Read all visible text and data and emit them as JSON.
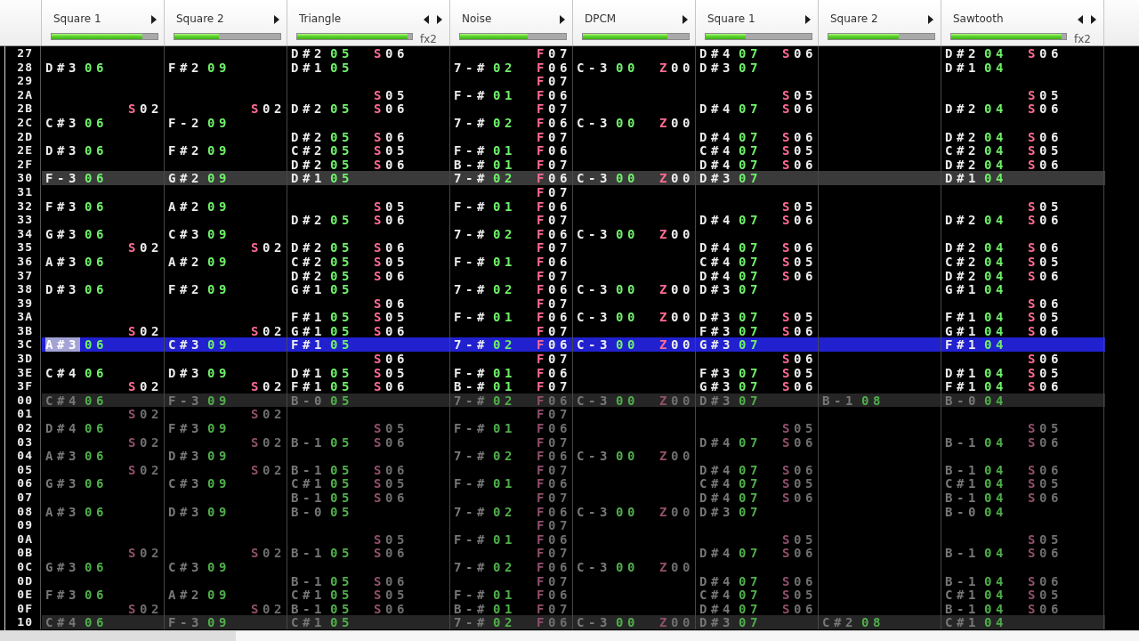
{
  "channels": [
    {
      "name": "Square 1",
      "contract_arrow": false,
      "expand_arrow": true,
      "level": 0.86
    },
    {
      "name": "Square 2",
      "contract_arrow": false,
      "expand_arrow": true,
      "level": 0.42
    },
    {
      "name": "Triangle",
      "contract_arrow": true,
      "expand_arrow": true,
      "level": 0.96,
      "fx_label": "fx2"
    },
    {
      "name": "Noise",
      "contract_arrow": false,
      "expand_arrow": true,
      "level": 0.64
    },
    {
      "name": "DPCM",
      "contract_arrow": false,
      "expand_arrow": true,
      "level": 0.8
    },
    {
      "name": "Square 1",
      "contract_arrow": false,
      "expand_arrow": true,
      "level": 0.38
    },
    {
      "name": "Square 2",
      "contract_arrow": false,
      "expand_arrow": true,
      "level": 0.66
    },
    {
      "name": "Sawtooth",
      "contract_arrow": true,
      "expand_arrow": true,
      "level": 0.96,
      "fx_label": "fx2"
    }
  ],
  "pattern": {
    "rows": [
      {
        "number": "27",
        "selected": false,
        "highlight": false,
        "cells": [
          null,
          null,
          {
            "note": "D#2",
            "instrument": "05",
            "effects": [
              "S06"
            ]
          },
          {
            "effects": [
              "F07"
            ]
          },
          null,
          {
            "note": "D#4",
            "instrument": "07",
            "effects": [
              "S06"
            ]
          },
          null,
          {
            "note": "D#2",
            "instrument": "04",
            "effects": [
              "S06"
            ]
          }
        ]
      },
      {
        "number": "28",
        "selected": false,
        "highlight": false,
        "cells": [
          {
            "note": "D#3",
            "instrument": "06"
          },
          {
            "note": "F#2",
            "instrument": "09"
          },
          {
            "note": "D#1",
            "instrument": "05"
          },
          {
            "note": "7-#",
            "instrument": "02",
            "effects": [
              "F06"
            ]
          },
          {
            "note": "C-3",
            "instrument": "00",
            "effects": [
              "Z00"
            ]
          },
          {
            "note": "D#3",
            "instrument": "07"
          },
          null,
          {
            "note": "D#1",
            "instrument": "04"
          }
        ]
      },
      {
        "number": "29",
        "selected": false,
        "highlight": false,
        "cells": [
          null,
          null,
          null,
          {
            "effects": [
              "F07"
            ]
          },
          null,
          null,
          null,
          null
        ]
      },
      {
        "number": "2A",
        "selected": false,
        "highlight": false,
        "cells": [
          null,
          null,
          {
            "effects": [
              "S05"
            ]
          },
          {
            "note": "F-#",
            "instrument": "01",
            "effects": [
              "F06"
            ]
          },
          null,
          {
            "effects": [
              "S05"
            ]
          },
          null,
          {
            "effects": [
              "S05"
            ]
          }
        ]
      },
      {
        "number": "2B",
        "selected": false,
        "highlight": false,
        "cells": [
          {
            "effects": [
              "S02"
            ]
          },
          {
            "effects": [
              "S02"
            ]
          },
          {
            "note": "D#2",
            "instrument": "05",
            "effects": [
              "S06"
            ]
          },
          {
            "effects": [
              "F07"
            ]
          },
          null,
          {
            "note": "D#4",
            "instrument": "07",
            "effects": [
              "S06"
            ]
          },
          null,
          {
            "note": "D#2",
            "instrument": "04",
            "effects": [
              "S06"
            ]
          }
        ]
      },
      {
        "number": "2C",
        "selected": false,
        "highlight": false,
        "cells": [
          {
            "note": "C#3",
            "instrument": "06"
          },
          {
            "note": "F-2",
            "instrument": "09"
          },
          null,
          {
            "note": "7-#",
            "instrument": "02",
            "effects": [
              "F06"
            ]
          },
          {
            "note": "C-3",
            "instrument": "00",
            "effects": [
              "Z00"
            ]
          },
          null,
          null,
          null
        ]
      },
      {
        "number": "2D",
        "selected": false,
        "highlight": false,
        "cells": [
          null,
          null,
          {
            "note": "D#2",
            "instrument": "05",
            "effects": [
              "S06"
            ]
          },
          {
            "effects": [
              "F07"
            ]
          },
          null,
          {
            "note": "D#4",
            "instrument": "07",
            "effects": [
              "S06"
            ]
          },
          null,
          {
            "note": "D#2",
            "instrument": "04",
            "effects": [
              "S06"
            ]
          }
        ]
      },
      {
        "number": "2E",
        "selected": false,
        "highlight": false,
        "cells": [
          {
            "note": "D#3",
            "instrument": "06"
          },
          {
            "note": "F#2",
            "instrument": "09"
          },
          {
            "note": "C#2",
            "instrument": "05",
            "effects": [
              "S05"
            ]
          },
          {
            "note": "F-#",
            "instrument": "01",
            "effects": [
              "F06"
            ]
          },
          null,
          {
            "note": "C#4",
            "instrument": "07",
            "effects": [
              "S05"
            ]
          },
          null,
          {
            "note": "C#2",
            "instrument": "04",
            "effects": [
              "S05"
            ]
          }
        ]
      },
      {
        "number": "2F",
        "selected": false,
        "highlight": false,
        "cells": [
          null,
          null,
          {
            "note": "D#2",
            "instrument": "05",
            "effects": [
              "S06"
            ]
          },
          {
            "note": "B-#",
            "instrument": "01",
            "effects": [
              "F07"
            ]
          },
          null,
          {
            "note": "D#4",
            "instrument": "07",
            "effects": [
              "S06"
            ]
          },
          null,
          {
            "note": "D#2",
            "instrument": "04",
            "effects": [
              "S06"
            ]
          }
        ]
      },
      {
        "number": "30",
        "selected": false,
        "highlight": true,
        "cells": [
          {
            "note": "F-3",
            "instrument": "06"
          },
          {
            "note": "G#2",
            "instrument": "09"
          },
          {
            "note": "D#1",
            "instrument": "05"
          },
          {
            "note": "7-#",
            "instrument": "02",
            "effects": [
              "F06"
            ]
          },
          {
            "note": "C-3",
            "instrument": "00",
            "effects": [
              "Z00"
            ]
          },
          {
            "note": "D#3",
            "instrument": "07"
          },
          null,
          {
            "note": "D#1",
            "instrument": "04"
          }
        ]
      },
      {
        "number": "31",
        "selected": false,
        "highlight": false,
        "cells": [
          null,
          null,
          null,
          {
            "effects": [
              "F07"
            ]
          },
          null,
          null,
          null,
          null
        ]
      },
      {
        "number": "32",
        "selected": false,
        "highlight": false,
        "cells": [
          {
            "note": "F#3",
            "instrument": "06"
          },
          {
            "note": "A#2",
            "instrument": "09"
          },
          {
            "effects": [
              "S05"
            ]
          },
          {
            "note": "F-#",
            "instrument": "01",
            "effects": [
              "F06"
            ]
          },
          null,
          {
            "effects": [
              "S05"
            ]
          },
          null,
          {
            "effects": [
              "S05"
            ]
          }
        ]
      },
      {
        "number": "33",
        "selected": false,
        "highlight": false,
        "cells": [
          null,
          null,
          {
            "note": "D#2",
            "instrument": "05",
            "effects": [
              "S06"
            ]
          },
          {
            "effects": [
              "F07"
            ]
          },
          null,
          {
            "note": "D#4",
            "instrument": "07",
            "effects": [
              "S06"
            ]
          },
          null,
          {
            "note": "D#2",
            "instrument": "04",
            "effects": [
              "S06"
            ]
          }
        ]
      },
      {
        "number": "34",
        "selected": false,
        "highlight": false,
        "cells": [
          {
            "note": "G#3",
            "instrument": "06"
          },
          {
            "note": "C#3",
            "instrument": "09"
          },
          null,
          {
            "note": "7-#",
            "instrument": "02",
            "effects": [
              "F06"
            ]
          },
          {
            "note": "C-3",
            "instrument": "00",
            "effects": [
              "Z00"
            ]
          },
          null,
          null,
          null
        ]
      },
      {
        "number": "35",
        "selected": false,
        "highlight": false,
        "cells": [
          {
            "effects": [
              "S02"
            ]
          },
          {
            "effects": [
              "S02"
            ]
          },
          {
            "note": "D#2",
            "instrument": "05",
            "effects": [
              "S06"
            ]
          },
          {
            "effects": [
              "F07"
            ]
          },
          null,
          {
            "note": "D#4",
            "instrument": "07",
            "effects": [
              "S06"
            ]
          },
          null,
          {
            "note": "D#2",
            "instrument": "04",
            "effects": [
              "S06"
            ]
          }
        ]
      },
      {
        "number": "36",
        "selected": false,
        "highlight": false,
        "cells": [
          {
            "note": "A#3",
            "instrument": "06"
          },
          {
            "note": "A#2",
            "instrument": "09"
          },
          {
            "note": "C#2",
            "instrument": "05",
            "effects": [
              "S05"
            ]
          },
          {
            "note": "F-#",
            "instrument": "01",
            "effects": [
              "F06"
            ]
          },
          null,
          {
            "note": "C#4",
            "instrument": "07",
            "effects": [
              "S05"
            ]
          },
          null,
          {
            "note": "C#2",
            "instrument": "04",
            "effects": [
              "S05"
            ]
          }
        ]
      },
      {
        "number": "37",
        "selected": false,
        "highlight": false,
        "cells": [
          null,
          null,
          {
            "note": "D#2",
            "instrument": "05",
            "effects": [
              "S06"
            ]
          },
          {
            "effects": [
              "F07"
            ]
          },
          null,
          {
            "note": "D#4",
            "instrument": "07",
            "effects": [
              "S06"
            ]
          },
          null,
          {
            "note": "D#2",
            "instrument": "04",
            "effects": [
              "S06"
            ]
          }
        ]
      },
      {
        "number": "38",
        "selected": false,
        "highlight": false,
        "cells": [
          {
            "note": "D#3",
            "instrument": "06"
          },
          {
            "note": "F#2",
            "instrument": "09"
          },
          {
            "note": "G#1",
            "instrument": "05"
          },
          {
            "note": "7-#",
            "instrument": "02",
            "effects": [
              "F06"
            ]
          },
          {
            "note": "C-3",
            "instrument": "00",
            "effects": [
              "Z00"
            ]
          },
          {
            "note": "D#3",
            "instrument": "07"
          },
          null,
          {
            "note": "G#1",
            "instrument": "04"
          }
        ]
      },
      {
        "number": "39",
        "selected": false,
        "highlight": false,
        "cells": [
          null,
          null,
          {
            "effects": [
              "S06"
            ]
          },
          {
            "effects": [
              "F07"
            ]
          },
          null,
          null,
          null,
          {
            "effects": [
              "S06"
            ]
          }
        ]
      },
      {
        "number": "3A",
        "selected": false,
        "highlight": false,
        "cells": [
          null,
          null,
          {
            "note": "F#1",
            "instrument": "05",
            "effects": [
              "S05"
            ]
          },
          {
            "note": "F-#",
            "instrument": "01",
            "effects": [
              "F06"
            ]
          },
          {
            "note": "C-3",
            "instrument": "00",
            "effects": [
              "Z00"
            ]
          },
          {
            "note": "D#3",
            "instrument": "07",
            "effects": [
              "S05"
            ]
          },
          null,
          {
            "note": "F#1",
            "instrument": "04",
            "effects": [
              "S05"
            ]
          }
        ]
      },
      {
        "number": "3B",
        "selected": false,
        "highlight": false,
        "cells": [
          {
            "effects": [
              "S02"
            ]
          },
          {
            "effects": [
              "S02"
            ]
          },
          {
            "note": "G#1",
            "instrument": "05",
            "effects": [
              "S06"
            ]
          },
          {
            "effects": [
              "F07"
            ]
          },
          null,
          {
            "note": "F#3",
            "instrument": "07",
            "effects": [
              "S06"
            ]
          },
          null,
          {
            "note": "G#1",
            "instrument": "04",
            "effects": [
              "S06"
            ]
          }
        ]
      },
      {
        "number": "3C",
        "selected": true,
        "highlight": false,
        "cells": [
          {
            "note": "A#3",
            "instrument": "06",
            "cursor": true
          },
          {
            "note": "C#3",
            "instrument": "09"
          },
          {
            "note": "F#1",
            "instrument": "05"
          },
          {
            "note": "7-#",
            "instrument": "02",
            "effects": [
              "F06"
            ]
          },
          {
            "note": "C-3",
            "instrument": "00",
            "effects": [
              "Z00"
            ]
          },
          {
            "note": "G#3",
            "instrument": "07"
          },
          null,
          {
            "note": "F#1",
            "instrument": "04"
          }
        ]
      },
      {
        "number": "3D",
        "selected": false,
        "highlight": false,
        "cells": [
          null,
          null,
          {
            "effects": [
              "S06"
            ]
          },
          {
            "effects": [
              "F07"
            ]
          },
          null,
          {
            "effects": [
              "S06"
            ]
          },
          null,
          {
            "effects": [
              "S06"
            ]
          }
        ]
      },
      {
        "number": "3E",
        "selected": false,
        "highlight": false,
        "cells": [
          {
            "note": "C#4",
            "instrument": "06"
          },
          {
            "note": "D#3",
            "instrument": "09"
          },
          {
            "note": "D#1",
            "instrument": "05",
            "effects": [
              "S05"
            ]
          },
          {
            "note": "F-#",
            "instrument": "01",
            "effects": [
              "F06"
            ]
          },
          null,
          {
            "note": "F#3",
            "instrument": "07",
            "effects": [
              "S05"
            ]
          },
          null,
          {
            "note": "D#1",
            "instrument": "04",
            "effects": [
              "S05"
            ]
          }
        ]
      },
      {
        "number": "3F",
        "selected": false,
        "highlight": false,
        "cells": [
          {
            "effects": [
              "S02"
            ]
          },
          {
            "effects": [
              "S02"
            ]
          },
          {
            "note": "F#1",
            "instrument": "05",
            "effects": [
              "S06"
            ]
          },
          {
            "note": "B-#",
            "instrument": "01",
            "effects": [
              "F07"
            ]
          },
          null,
          {
            "note": "G#3",
            "instrument": "07",
            "effects": [
              "S06"
            ]
          },
          null,
          {
            "note": "F#1",
            "instrument": "04",
            "effects": [
              "S06"
            ]
          }
        ]
      }
    ]
  },
  "next_pattern_preview": {
    "rows": [
      {
        "number": "00",
        "selected": false,
        "highlight": true,
        "cells": [
          {
            "note": "C#4",
            "instrument": "06"
          },
          {
            "note": "F-3",
            "instrument": "09"
          },
          {
            "note": "B-0",
            "instrument": "05"
          },
          {
            "note": "7-#",
            "instrument": "02",
            "effects": [
              "F06"
            ]
          },
          {
            "note": "C-3",
            "instrument": "00",
            "effects": [
              "Z00"
            ]
          },
          {
            "note": "D#3",
            "instrument": "07"
          },
          {
            "note": "B-1",
            "instrument": "08"
          },
          {
            "note": "B-0",
            "instrument": "04"
          }
        ]
      },
      {
        "number": "01",
        "selected": false,
        "highlight": false,
        "cells": [
          {
            "effects": [
              "S02"
            ]
          },
          {
            "effects": [
              "S02"
            ]
          },
          null,
          {
            "effects": [
              "F07"
            ]
          },
          null,
          null,
          null,
          null
        ]
      },
      {
        "number": "02",
        "selected": false,
        "highlight": false,
        "cells": [
          {
            "note": "D#4",
            "instrument": "06"
          },
          {
            "note": "F#3",
            "instrument": "09"
          },
          {
            "effects": [
              "S05"
            ]
          },
          {
            "note": "F-#",
            "instrument": "01",
            "effects": [
              "F06"
            ]
          },
          null,
          {
            "effects": [
              "S05"
            ]
          },
          null,
          {
            "effects": [
              "S05"
            ]
          }
        ]
      },
      {
        "number": "03",
        "selected": false,
        "highlight": false,
        "cells": [
          {
            "effects": [
              "S02"
            ]
          },
          {
            "effects": [
              "S02"
            ]
          },
          {
            "note": "B-1",
            "instrument": "05",
            "effects": [
              "S06"
            ]
          },
          {
            "effects": [
              "F07"
            ]
          },
          null,
          {
            "note": "D#4",
            "instrument": "07",
            "effects": [
              "S06"
            ]
          },
          null,
          {
            "note": "B-1",
            "instrument": "04",
            "effects": [
              "S06"
            ]
          }
        ]
      },
      {
        "number": "04",
        "selected": false,
        "highlight": false,
        "cells": [
          {
            "note": "A#3",
            "instrument": "06"
          },
          {
            "note": "D#3",
            "instrument": "09"
          },
          null,
          {
            "note": "7-#",
            "instrument": "02",
            "effects": [
              "F06"
            ]
          },
          {
            "note": "C-3",
            "instrument": "00",
            "effects": [
              "Z00"
            ]
          },
          null,
          null,
          null
        ]
      },
      {
        "number": "05",
        "selected": false,
        "highlight": false,
        "cells": [
          {
            "effects": [
              "S02"
            ]
          },
          {
            "effects": [
              "S02"
            ]
          },
          {
            "note": "B-1",
            "instrument": "05",
            "effects": [
              "S06"
            ]
          },
          {
            "effects": [
              "F07"
            ]
          },
          null,
          {
            "note": "D#4",
            "instrument": "07",
            "effects": [
              "S06"
            ]
          },
          null,
          {
            "note": "B-1",
            "instrument": "04",
            "effects": [
              "S06"
            ]
          }
        ]
      },
      {
        "number": "06",
        "selected": false,
        "highlight": false,
        "cells": [
          {
            "note": "G#3",
            "instrument": "06"
          },
          {
            "note": "C#3",
            "instrument": "09"
          },
          {
            "note": "C#1",
            "instrument": "05",
            "effects": [
              "S05"
            ]
          },
          {
            "note": "F-#",
            "instrument": "01",
            "effects": [
              "F06"
            ]
          },
          null,
          {
            "note": "C#4",
            "instrument": "07",
            "effects": [
              "S05"
            ]
          },
          null,
          {
            "note": "C#1",
            "instrument": "04",
            "effects": [
              "S05"
            ]
          }
        ]
      },
      {
        "number": "07",
        "selected": false,
        "highlight": false,
        "cells": [
          null,
          null,
          {
            "note": "B-1",
            "instrument": "05",
            "effects": [
              "S06"
            ]
          },
          {
            "effects": [
              "F07"
            ]
          },
          null,
          {
            "note": "D#4",
            "instrument": "07",
            "effects": [
              "S06"
            ]
          },
          null,
          {
            "note": "B-1",
            "instrument": "04",
            "effects": [
              "S06"
            ]
          }
        ]
      },
      {
        "number": "08",
        "selected": false,
        "highlight": false,
        "cells": [
          {
            "note": "A#3",
            "instrument": "06"
          },
          {
            "note": "D#3",
            "instrument": "09"
          },
          {
            "note": "B-0",
            "instrument": "05"
          },
          {
            "note": "7-#",
            "instrument": "02",
            "effects": [
              "F06"
            ]
          },
          {
            "note": "C-3",
            "instrument": "00",
            "effects": [
              "Z00"
            ]
          },
          {
            "note": "D#3",
            "instrument": "07"
          },
          null,
          {
            "note": "B-0",
            "instrument": "04"
          }
        ]
      },
      {
        "number": "09",
        "selected": false,
        "highlight": false,
        "cells": [
          null,
          null,
          null,
          {
            "effects": [
              "F07"
            ]
          },
          null,
          null,
          null,
          null
        ]
      },
      {
        "number": "0A",
        "selected": false,
        "highlight": false,
        "cells": [
          null,
          null,
          {
            "effects": [
              "S05"
            ]
          },
          {
            "note": "F-#",
            "instrument": "01",
            "effects": [
              "F06"
            ]
          },
          null,
          {
            "effects": [
              "S05"
            ]
          },
          null,
          {
            "effects": [
              "S05"
            ]
          }
        ]
      },
      {
        "number": "0B",
        "selected": false,
        "highlight": false,
        "cells": [
          {
            "effects": [
              "S02"
            ]
          },
          {
            "effects": [
              "S02"
            ]
          },
          {
            "note": "B-1",
            "instrument": "05",
            "effects": [
              "S06"
            ]
          },
          {
            "effects": [
              "F07"
            ]
          },
          null,
          {
            "note": "D#4",
            "instrument": "07",
            "effects": [
              "S06"
            ]
          },
          null,
          {
            "note": "B-1",
            "instrument": "04",
            "effects": [
              "S06"
            ]
          }
        ]
      },
      {
        "number": "0C",
        "selected": false,
        "highlight": false,
        "cells": [
          {
            "note": "G#3",
            "instrument": "06"
          },
          {
            "note": "C#3",
            "instrument": "09"
          },
          null,
          {
            "note": "7-#",
            "instrument": "02",
            "effects": [
              "F06"
            ]
          },
          {
            "note": "C-3",
            "instrument": "00",
            "effects": [
              "Z00"
            ]
          },
          null,
          null,
          null
        ]
      },
      {
        "number": "0D",
        "selected": false,
        "highlight": false,
        "cells": [
          null,
          null,
          {
            "note": "B-1",
            "instrument": "05",
            "effects": [
              "S06"
            ]
          },
          {
            "effects": [
              "F07"
            ]
          },
          null,
          {
            "note": "D#4",
            "instrument": "07",
            "effects": [
              "S06"
            ]
          },
          null,
          {
            "note": "B-1",
            "instrument": "04",
            "effects": [
              "S06"
            ]
          }
        ]
      },
      {
        "number": "0E",
        "selected": false,
        "highlight": false,
        "cells": [
          {
            "note": "F#3",
            "instrument": "06"
          },
          {
            "note": "A#2",
            "instrument": "09"
          },
          {
            "note": "C#1",
            "instrument": "05",
            "effects": [
              "S05"
            ]
          },
          {
            "note": "F-#",
            "instrument": "01",
            "effects": [
              "F06"
            ]
          },
          null,
          {
            "note": "C#4",
            "instrument": "07",
            "effects": [
              "S05"
            ]
          },
          null,
          {
            "note": "C#1",
            "instrument": "04",
            "effects": [
              "S05"
            ]
          }
        ]
      },
      {
        "number": "0F",
        "selected": false,
        "highlight": false,
        "cells": [
          {
            "effects": [
              "S02"
            ]
          },
          {
            "effects": [
              "S02"
            ]
          },
          {
            "note": "B-1",
            "instrument": "05",
            "effects": [
              "S06"
            ]
          },
          {
            "note": "B-#",
            "instrument": "01",
            "effects": [
              "F07"
            ]
          },
          null,
          {
            "note": "D#4",
            "instrument": "07",
            "effects": [
              "S06"
            ]
          },
          null,
          {
            "note": "B-1",
            "instrument": "04",
            "effects": [
              "S06"
            ]
          }
        ]
      },
      {
        "number": "10",
        "selected": false,
        "highlight": true,
        "cells": [
          {
            "note": "C#4",
            "instrument": "06"
          },
          {
            "note": "F-3",
            "instrument": "09"
          },
          {
            "note": "C#1",
            "instrument": "05"
          },
          {
            "note": "7-#",
            "instrument": "02",
            "effects": [
              "F06"
            ]
          },
          {
            "note": "C-3",
            "instrument": "00",
            "effects": [
              "Z00"
            ]
          },
          {
            "note": "D#3",
            "instrument": "07"
          },
          {
            "note": "C#2",
            "instrument": "08"
          },
          {
            "note": "C#1",
            "instrument": "04"
          }
        ]
      }
    ]
  }
}
